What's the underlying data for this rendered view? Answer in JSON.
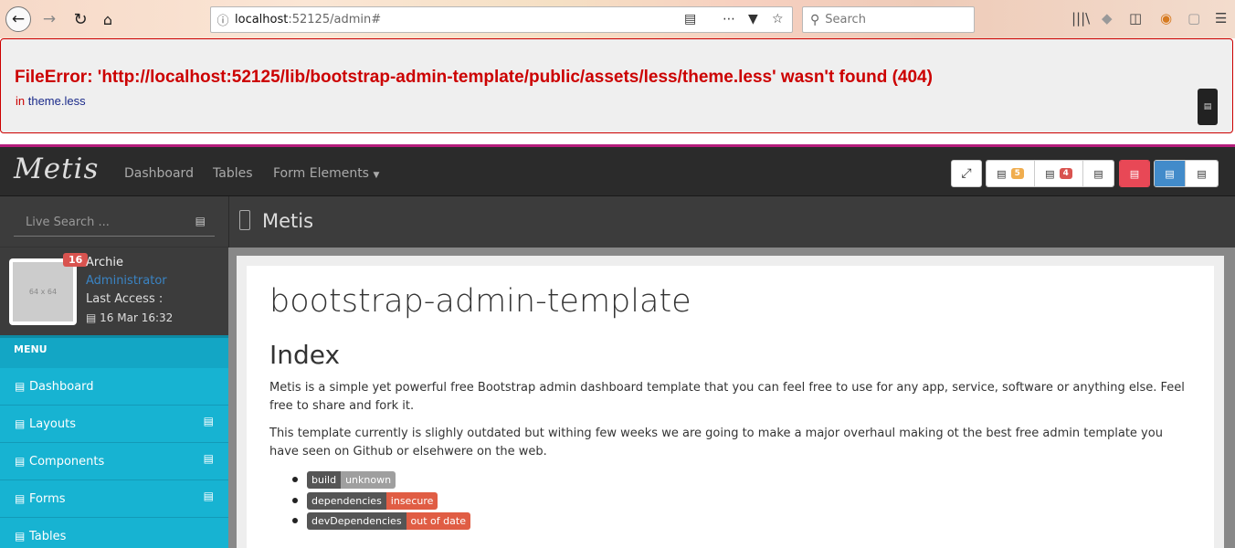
{
  "browser": {
    "url_host": "localhost",
    "url_rest": ":52125/admin#",
    "search_placeholder": "Search"
  },
  "error": {
    "message": "FileError: 'http://localhost:52125/lib/bootstrap-admin-template/public/assets/less/theme.less' wasn't found (404)",
    "location_prefix": "in ",
    "location_file": "theme.less"
  },
  "topnav": {
    "brand": "Metis",
    "links": [
      "Dashboard",
      "Tables",
      "Form Elements"
    ],
    "badges": [
      {
        "count": "5",
        "color": "#f0ad4e"
      },
      {
        "count": "4",
        "color": "#d9534f"
      }
    ],
    "accent_colors": {
      "red": "#e84856",
      "blue": "#428bca"
    }
  },
  "sidebar": {
    "search_placeholder": "Live Search ...",
    "user": {
      "badge": "16",
      "avatar_text": "64 x 64",
      "name": "Archie",
      "role": "Administrator",
      "access_label": "Last Access :",
      "access_time": "16 Mar 16:32"
    },
    "menu_title": "MENU",
    "menu_items": [
      {
        "label": "Dashboard"
      },
      {
        "label": "Layouts"
      },
      {
        "label": "Components"
      },
      {
        "label": "Forms"
      },
      {
        "label": "Tables"
      }
    ]
  },
  "content": {
    "header_title": "Metis",
    "h1": "bootstrap-admin-template",
    "h2": "Index",
    "p1": "Metis is a simple yet powerful free Bootstrap admin dashboard template that you can feel free to use for any app, service, software or anything else. Feel free to share and fork it.",
    "p2": "This template currently is slighly outdated but withing few weeks we are going to make a major overhaul making ot the best free admin template you have seen on Github or elsehwere on the web.",
    "shields": [
      {
        "key": "build",
        "value": "unknown",
        "color": "#9f9f9f"
      },
      {
        "key": "dependencies",
        "value": "insecure",
        "color": "#e05d44"
      },
      {
        "key": "devDependencies",
        "value": "out of date",
        "color": "#e05d44"
      }
    ]
  }
}
